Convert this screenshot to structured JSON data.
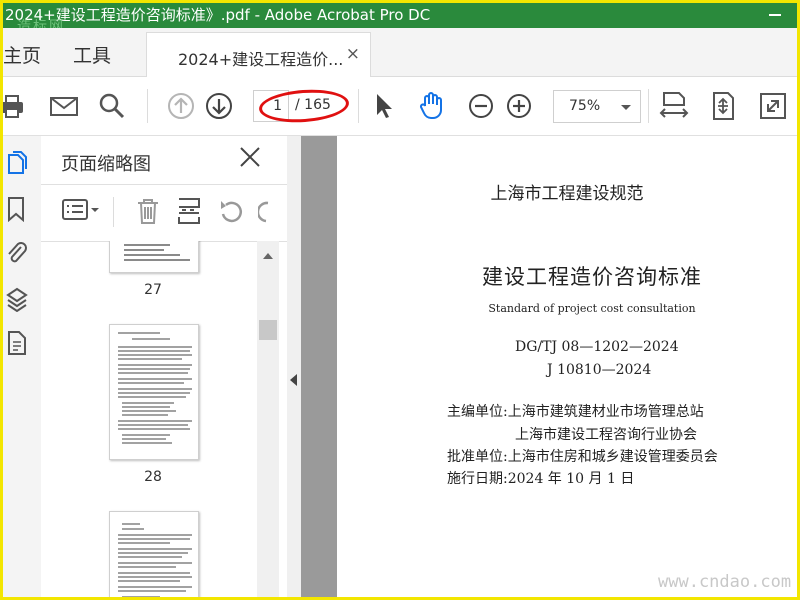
{
  "window": {
    "title": "2024+建设工程造价咨询标准》.pdf - Adobe Acrobat Pro DC",
    "watermark": "造标网"
  },
  "menu": {
    "home": "主页",
    "tools": "工具"
  },
  "tab": {
    "label": "2024+建设工程造价...",
    "close": "×"
  },
  "toolbar": {
    "current_page": "1",
    "total_pages": "/ 165",
    "zoom": "75%"
  },
  "thumbnail_panel": {
    "title": "页面缩略图",
    "pages": [
      {
        "label": "27"
      },
      {
        "label": "28"
      },
      {
        "label": ""
      }
    ]
  },
  "document": {
    "header": "上海市工程建设规范",
    "title": "建设工程造价咨询标准",
    "subtitle": "Standard of project cost consultation",
    "code1": "DG/TJ 08—1202—2024",
    "code2": "J 10810—2024",
    "lines": [
      "主编单位:上海市建筑建材业市场管理总站",
      "上海市建设工程咨询行业协会",
      "批准单位:上海市住房和城乡建设管理委员会",
      "施行日期:2024 年 10 月 1 日"
    ]
  },
  "footer_watermark": "www.cndao.com",
  "colors": {
    "titlebar": "#2a8a3c",
    "accent": "#1473e6",
    "annotation": "#e01010",
    "frame": "#f3e600"
  }
}
